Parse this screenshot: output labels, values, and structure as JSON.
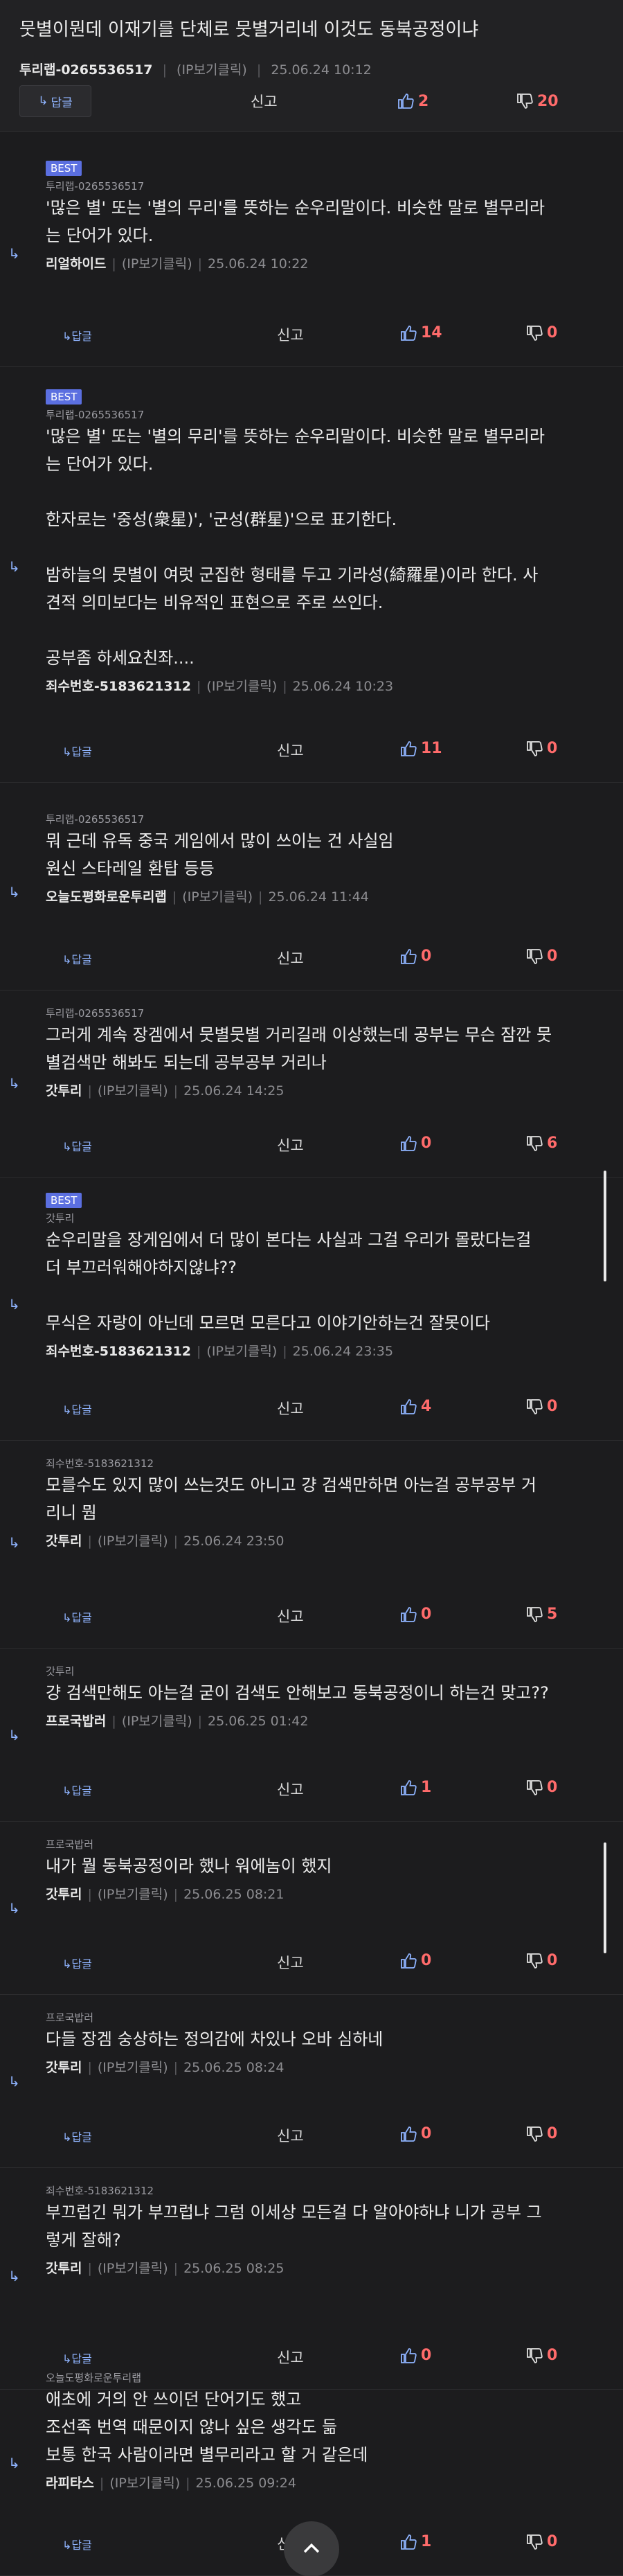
{
  "post": {
    "title": "뭇별이뭔데 이재기를 단체로 뭇별거리네 이것도 동북공정이냐",
    "author": "투리랩-0265536517",
    "ip": "(IP보기클릭)",
    "date": "25.06.24 10:12",
    "reply_label": "답글",
    "report_label": "신고",
    "likes": "2",
    "dislikes": "20"
  },
  "comments": [
    {
      "best": "BEST",
      "reply_to": "투리랩-0265536517",
      "text": "'많은 별' 또는 '별의 무리'를 뜻하는 순우리말이다. 비슷한 말로 별무리라\n는 단어가 있다.",
      "author": "리얼하이드",
      "ip": "(IP보기클릭)",
      "date": "25.06.24 10:22",
      "reply": "답글",
      "report": "신고",
      "likes": "14",
      "dislikes": "0"
    },
    {
      "best": "BEST",
      "reply_to": "투리랩-0265536517",
      "text": "'많은 별' 또는 '별의 무리'를 뜻하는 순우리말이다. 비슷한 말로 별무리라\n는 단어가 있다.\n\n한자로는 '중성(衆星)', '군성(群星)'으로 표기한다.\n\n밤하늘의 뭇별이 여럿 군집한 형태를 두고 기라성(綺羅星)이라 한다. 사\n견적 의미보다는 비유적인 표현으로 주로 쓰인다.\n\n공부좀 하세요친좌....",
      "author": "죄수번호-5183621312",
      "ip": "(IP보기클릭)",
      "date": "25.06.24 10:23",
      "reply": "답글",
      "report": "신고",
      "likes": "11",
      "dislikes": "0"
    },
    {
      "best": "",
      "reply_to": "투리랩-0265536517",
      "text": "뭐 근데 유독 중국 게임에서 많이 쓰이는 건 사실임\n원신 스타레일 환탑 등등",
      "author": "오늘도평화로운투리랩",
      "ip": "(IP보기클릭)",
      "date": "25.06.24 11:44",
      "reply": "답글",
      "report": "신고",
      "likes": "0",
      "dislikes": "0"
    },
    {
      "best": "",
      "reply_to": "투리랩-0265536517",
      "text": "그러게 계속 장겜에서 뭇별뭇별 거리길래 이상했는데 공부는 무슨 잠깐 뭇\n별검색만 해봐도 되는데 공부공부 거리나",
      "author": "갓투리",
      "ip": "(IP보기클릭)",
      "date": "25.06.24 14:25",
      "reply": "답글",
      "report": "신고",
      "likes": "0",
      "dislikes": "6"
    },
    {
      "best": "BEST",
      "reply_to": "갓투리",
      "text": "순우리말을 장게임에서 더 많이 본다는 사실과 그걸 우리가 몰랐다는걸\n더 부끄러워해야하지않냐??\n\n무식은 자랑이 아닌데 모르면 모른다고 이야기안하는건 잘못이다",
      "author": "죄수번호-5183621312",
      "ip": "(IP보기클릭)",
      "date": "25.06.24 23:35",
      "reply": "답글",
      "report": "신고",
      "likes": "4",
      "dislikes": "0"
    },
    {
      "best": "",
      "reply_to": "죄수번호-5183621312",
      "text": "모를수도 있지 많이 쓰는것도 아니고 걍 검색만하면 아는걸 공부공부 거\n리니 뭠",
      "author": "갓투리",
      "ip": "(IP보기클릭)",
      "date": "25.06.24 23:50",
      "reply": "답글",
      "report": "신고",
      "likes": "0",
      "dislikes": "5"
    },
    {
      "best": "",
      "reply_to": "갓투리",
      "text": "걍 검색만해도 아는걸 굳이 검색도 안해보고 동북공정이니 하는건 맞고??",
      "author": "프로국밥러",
      "ip": "(IP보기클릭)",
      "date": "25.06.25 01:42",
      "reply": "답글",
      "report": "신고",
      "likes": "1",
      "dislikes": "0"
    },
    {
      "best": "",
      "reply_to": "프로국밥러",
      "text": "내가 뭘 동북공정이라 했나 워에놈이 했지",
      "author": "갓투리",
      "ip": "(IP보기클릭)",
      "date": "25.06.25 08:21",
      "reply": "답글",
      "report": "신고",
      "likes": "0",
      "dislikes": "0"
    },
    {
      "best": "",
      "reply_to": "프로국밥러",
      "text": "다들 장겜 숭상하는 정의감에 차있나 오바 심하네",
      "author": "갓투리",
      "ip": "(IP보기클릭)",
      "date": "25.06.25 08:24",
      "reply": "답글",
      "report": "신고",
      "likes": "0",
      "dislikes": "0"
    },
    {
      "best": "",
      "reply_to": "죄수번호-5183621312",
      "text": "부끄럽긴 뭐가 부끄럽냐 그럼 이세상 모든걸 다 알아야하냐 니가 공부 그\n렇게 잘해?",
      "author": "갓투리",
      "ip": "(IP보기클릭)",
      "date": "25.06.25 08:25",
      "reply": "답글",
      "report": "신고",
      "likes": "0",
      "dislikes": "0"
    },
    {
      "best": "",
      "reply_to": "오늘도평화로운투리랩",
      "text": "애초에 거의 안 쓰이던 단어기도 했고\n조선족 번역 때문이지 않나 싶은 생각도 듦\n보통 한국 사람이라면 별무리라고 할 거 같은데",
      "author": "라피타스",
      "ip": "(IP보기클릭)",
      "date": "25.06.25 09:24",
      "reply": "답글",
      "report": "신고",
      "likes": "1",
      "dislikes": "0"
    }
  ],
  "icons": {
    "reply_arrow": "reply-arrow-icon",
    "thumbs_up": "thumbs-up-icon",
    "thumbs_down": "thumbs-down-icon",
    "scroll_top": "chevron-up-icon"
  },
  "colors": {
    "background": "#1c1c1e",
    "accent": "#8fb4ff",
    "best_badge": "#5b6fe0",
    "count": "#ff6b6b"
  }
}
